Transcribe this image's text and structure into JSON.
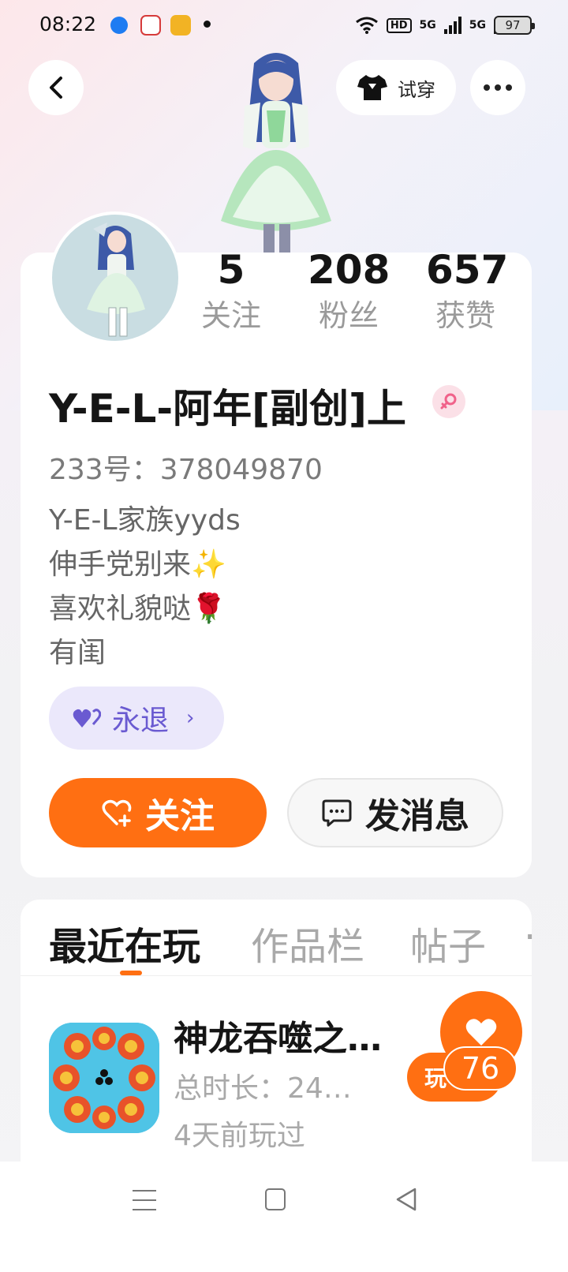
{
  "status_bar": {
    "time": "08:22",
    "network_hd": "HD",
    "network_1": "5G",
    "network_2": "5G",
    "battery": "97"
  },
  "header": {
    "tryon_label": "试穿",
    "icons": [
      "back-chevron-icon",
      "tshirt-icon",
      "more-icon"
    ]
  },
  "profile": {
    "stats": [
      {
        "value": "5",
        "label": "关注"
      },
      {
        "value": "208",
        "label": "粉丝"
      },
      {
        "value": "657",
        "label": "获赞"
      }
    ],
    "nickname": "Y-E-L-阿年[副创]上",
    "gender": "female",
    "uid": "233号：378049870",
    "bio": [
      "Y-E-L家族yyds",
      "伸手党别来✨",
      "喜欢礼貌哒🌹",
      "有闺"
    ],
    "badge_label": "永退",
    "follow_label": "关注",
    "message_label": "发消息"
  },
  "tabs": {
    "items": [
      "最近在玩",
      "作品栏",
      "帖子"
    ],
    "overflow": "·",
    "active": "最近在玩"
  },
  "recent_game": {
    "title": "神龙吞噬之…",
    "play_time": "总时长：24…",
    "last_played": "4天前玩过",
    "play_label": "玩",
    "like_count": "76"
  },
  "colors": {
    "accent": "#ff6f12",
    "badge_bg": "#ebe8fb",
    "badge_text": "#6a5ad1"
  }
}
